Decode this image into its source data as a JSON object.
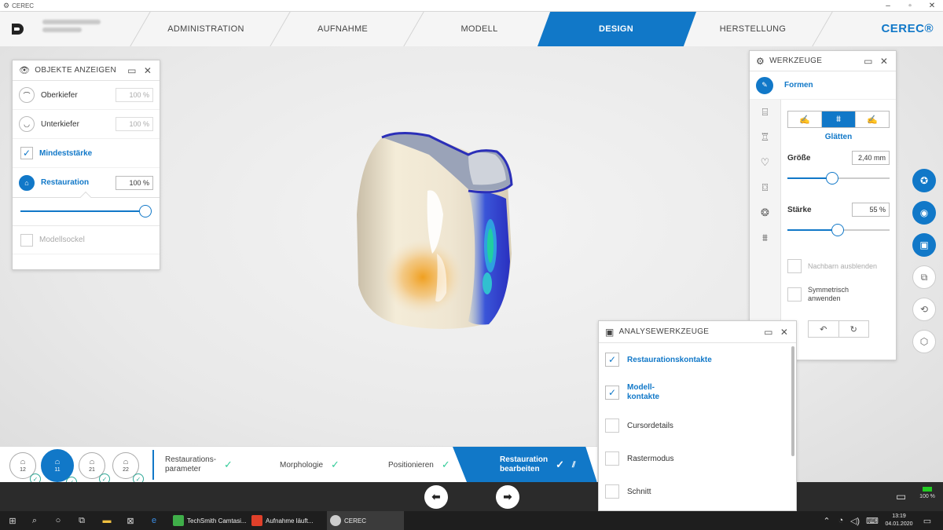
{
  "window": {
    "title": "CEREC",
    "min": "–",
    "max": "▫",
    "close": "✕"
  },
  "nav": {
    "tabs": [
      {
        "label": "ADMINISTRATION"
      },
      {
        "label": "AUFNAHME"
      },
      {
        "label": "MODELL"
      },
      {
        "label": "DESIGN"
      },
      {
        "label": "HERSTELLUNG"
      }
    ],
    "brand": "CEREC®"
  },
  "objects_panel": {
    "title": "OBJEKTE ANZEIGEN",
    "rows": [
      {
        "label": "Oberkiefer",
        "value": "100 %"
      },
      {
        "label": "Unterkiefer",
        "value": "100 %"
      },
      {
        "label": "Mindeststärke"
      },
      {
        "label": "Restauration",
        "value": "100 %"
      },
      {
        "label": "Modellsockel"
      }
    ],
    "opacity_fraction": 1.0
  },
  "tools_panel": {
    "title": "WERKZEUGE",
    "tool_name": "Formen",
    "mode_label": "Glätten",
    "size_label": "Größe",
    "size_value": "2,40 mm",
    "size_fraction": 0.43,
    "strength_label": "Stärke",
    "strength_value": "55 %",
    "strength_fraction": 0.49,
    "hide_neighbors_label": "Nachbarn ausblenden",
    "symmetric_label": "Symmetrisch anwenden"
  },
  "analysis_panel": {
    "title": "ANALYSEWERKZEUGE",
    "rows": [
      {
        "label": "Restaurationskontakte"
      },
      {
        "label": "Modell-\nkontakte"
      },
      {
        "label": "Cursordetails"
      },
      {
        "label": "Rastermodus"
      },
      {
        "label": "Schnitt"
      }
    ]
  },
  "workflow": {
    "teeth": [
      {
        "number": "12"
      },
      {
        "number": "11"
      },
      {
        "number": "21"
      },
      {
        "number": "22"
      }
    ],
    "steps": [
      {
        "label": "Restaurations-\nparameter"
      },
      {
        "label": "Morphologie"
      },
      {
        "label": "Positionieren"
      },
      {
        "label": "Restauration\nbearbeiten"
      }
    ]
  },
  "status": {
    "battery": "100 %"
  },
  "taskbar": {
    "apps": [
      {
        "label": "TechSmith Camtasi..."
      },
      {
        "label": "Aufnahme läuft..."
      },
      {
        "label": "CEREC"
      }
    ],
    "time": "13:19",
    "date": "04.01.2020"
  },
  "colors": {
    "accent": "#1178c8",
    "ok": "#33cc99"
  }
}
